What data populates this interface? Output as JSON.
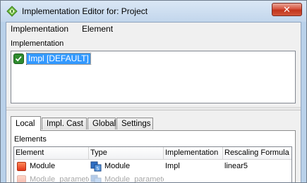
{
  "window": {
    "title": "Implementation Editor for: Project",
    "close_label": "✕"
  },
  "menu": {
    "items": [
      "Implementation",
      "Element"
    ]
  },
  "implementation_section": {
    "label": "Implementation",
    "items": [
      {
        "name": "Impl [DEFAULT]",
        "selected": true,
        "checked": true
      }
    ]
  },
  "tabs": [
    {
      "label": "Local",
      "active": true
    },
    {
      "label": "Impl. Cast",
      "active": false
    },
    {
      "label": "Global",
      "active": false
    },
    {
      "label": "Settings",
      "active": false
    }
  ],
  "elements_section": {
    "label": "Elements",
    "columns": [
      "Element",
      "Type",
      "Implementation",
      "Rescaling Formula"
    ],
    "rows": [
      {
        "element": "Module",
        "type": "Module",
        "implementation": "Impl",
        "rescaling": "linear5"
      },
      {
        "element": "Module_parameter",
        "type": "Module_parameter",
        "implementation": "",
        "rescaling": ""
      }
    ]
  },
  "colors": {
    "selection": "#3399ff",
    "module_icon": "#e2361a",
    "check_icon": "#2e8b2e"
  }
}
